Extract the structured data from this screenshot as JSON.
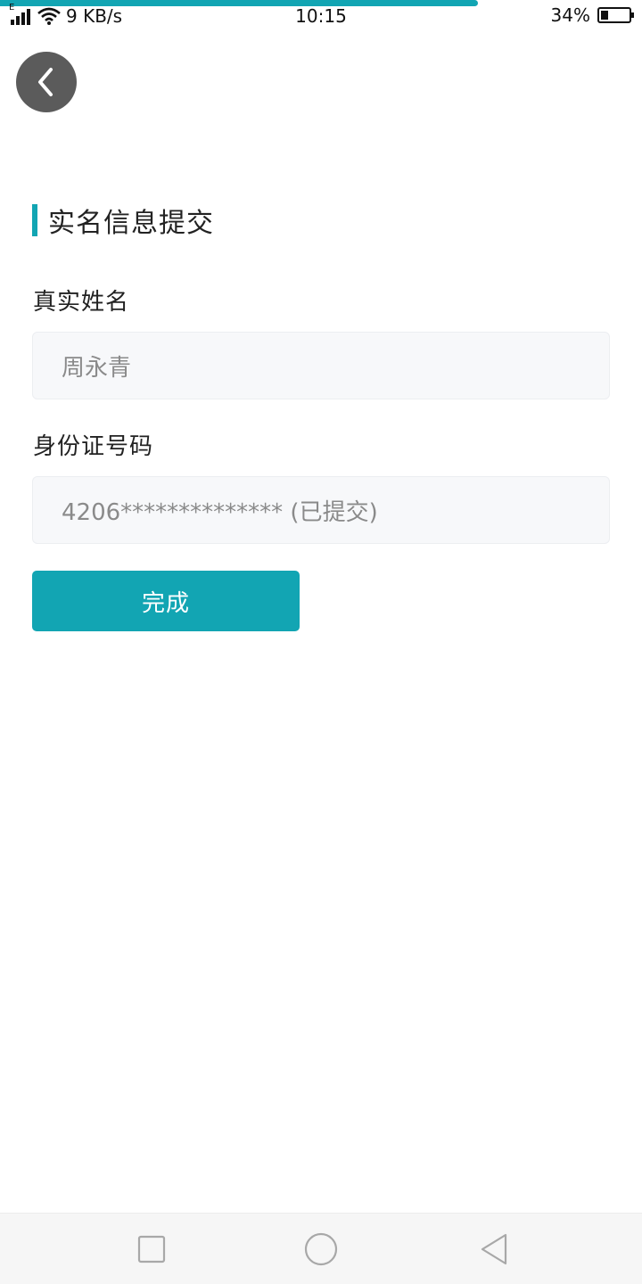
{
  "status_bar": {
    "network_type": "E",
    "speed": "9 KB/s",
    "time": "10:15",
    "battery_percent": "34%",
    "battery_level": 0.34
  },
  "page_load_progress": 0.745,
  "back_icon": "chevron-left-icon",
  "section_title": "实名信息提交",
  "form": {
    "name_label": "真实姓名",
    "name_value": "周永青",
    "id_label": "身份证号码",
    "id_value": "4206************** (已提交)"
  },
  "submit_label": "完成",
  "nav": {
    "recent_icon": "square-icon",
    "home_icon": "circle-icon",
    "back_icon": "triangle-back-icon"
  },
  "colors": {
    "accent": "#12a5b3",
    "back_button_bg": "#5b5b5b",
    "field_bg": "#f7f8fa",
    "placeholder_text": "#8a8a8a"
  }
}
